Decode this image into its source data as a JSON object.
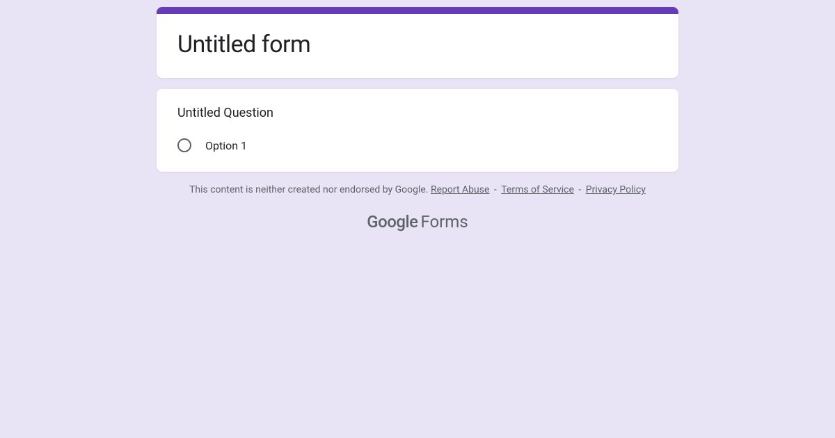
{
  "form": {
    "title": "Untitled form",
    "question": {
      "title": "Untitled Question",
      "options": [
        {
          "label": "Option 1"
        }
      ]
    }
  },
  "footer": {
    "disclaimer_text": "This content is neither created nor endorsed by Google. ",
    "report_abuse": "Report Abuse",
    "sep1": " - ",
    "terms": "Terms of Service",
    "sep2": " - ",
    "privacy": "Privacy Policy",
    "brand_google": "Google",
    "brand_forms": " Forms"
  }
}
